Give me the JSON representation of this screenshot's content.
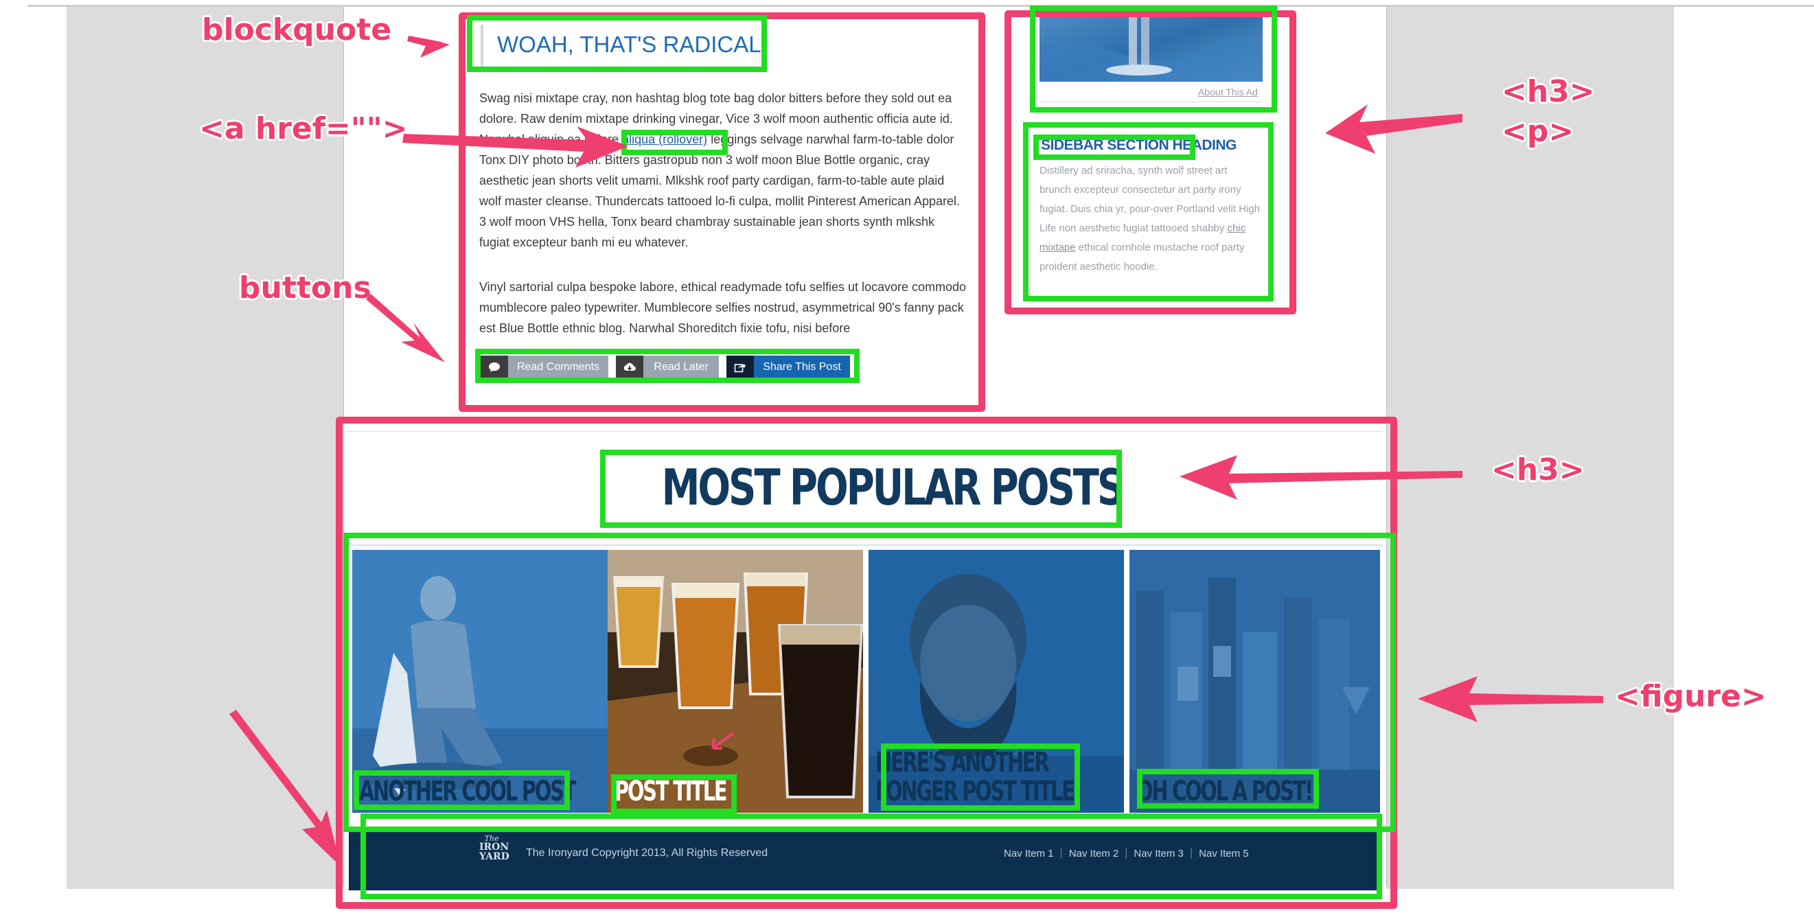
{
  "annotations": {
    "blockquote": "blockquote",
    "a_href": "<a href=\"\">",
    "buttons": "buttons",
    "h3_p_line1": "<h3>",
    "h3_p_line2": "<p>",
    "h3_popular": "<h3>",
    "figure": "<figure>"
  },
  "post": {
    "blockquote": "WOAH, THAT'S RADICAL!",
    "para1_before_link": "Swag nisi mixtape cray, non hashtag blog tote bag dolor bitters before they sold out ea dolore. Raw denim mixtape drinking vinegar, Vice 3 wolf moon authentic officia aute id. Narwhal aliquip ea dolore ",
    "link_text": "aliqua (rollover)",
    "para1_after_link": " leggings selvage narwhal farm-to-table dolor Tonx DIY photo booth. Bitters gastropub non 3 wolf moon Blue Bottle organic, cray aesthetic jean shorts velit umami. Mlkshk roof party cardigan, farm-to-table aute plaid wolf master cleanse. Thundercats tattooed lo-fi culpa, mollit Pinterest American Apparel. 3 wolf moon VHS hella, Tonx beard chambray sustainable jean shorts synth mlkshk fugiat excepteur banh mi eu whatever.",
    "para2": "Vinyl sartorial culpa bespoke labore, ethical readymade tofu selfies ut locavore commodo mumblecore paleo typewriter. Mumblecore selfies nostrud, asymmetrical 90's fanny pack est Blue Bottle ethnic blog. Narwhal Shoreditch fixie tofu, nisi before",
    "buttons": [
      {
        "label": "Read Comments",
        "icon": "comment-icon"
      },
      {
        "label": "Read Later",
        "icon": "cloud-download-icon"
      },
      {
        "label": "Share This Post",
        "icon": "share-icon"
      }
    ]
  },
  "sidebar": {
    "about_ad": "About This Ad",
    "heading": "SIDEBAR SECTION HEADING",
    "text_before_link": "Distillery ad sriracha, synth wolf street art brunch excepteur consectetur art party irony fugiat. Duis chia yr, pour-over Portland velit High Life non aesthetic fugiat tattooed shabby ",
    "link_text": "chic mixtape",
    "text_after_link": " ethical cornhole mustache roof party proident aesthetic hoodie."
  },
  "popular": {
    "heading": "MOST POPULAR POSTS",
    "figures": [
      {
        "title_lines": [
          "ANOTHER COOL POST"
        ],
        "image": "surfer-photo"
      },
      {
        "title_lines": [
          "POST TITLE"
        ],
        "image": "beer-flight-photo"
      },
      {
        "title_lines": [
          "HERE'S ANOTHER",
          "LONGER POST TITLE"
        ],
        "image": "bearded-man-photo"
      },
      {
        "title_lines": [
          "OH COOL A POST!"
        ],
        "image": "bar-bottles-photo"
      }
    ]
  },
  "footer": {
    "logo_line1": "The",
    "logo_line2": "IRON",
    "logo_line3": "YARD",
    "copyright": "The Ironyard Copyright 2013, All Rights Reserved",
    "nav": [
      "Nav Item 1",
      "Nav Item 2",
      "Nav Item 3",
      "Nav Item 5"
    ]
  },
  "colors": {
    "annotation_pink": "#ee3f6e",
    "annotation_green": "#22dd22",
    "brand_blue": "#1f6bb8",
    "footer_navy": "#0d2f4f",
    "share_button_blue": "#1565b0"
  }
}
